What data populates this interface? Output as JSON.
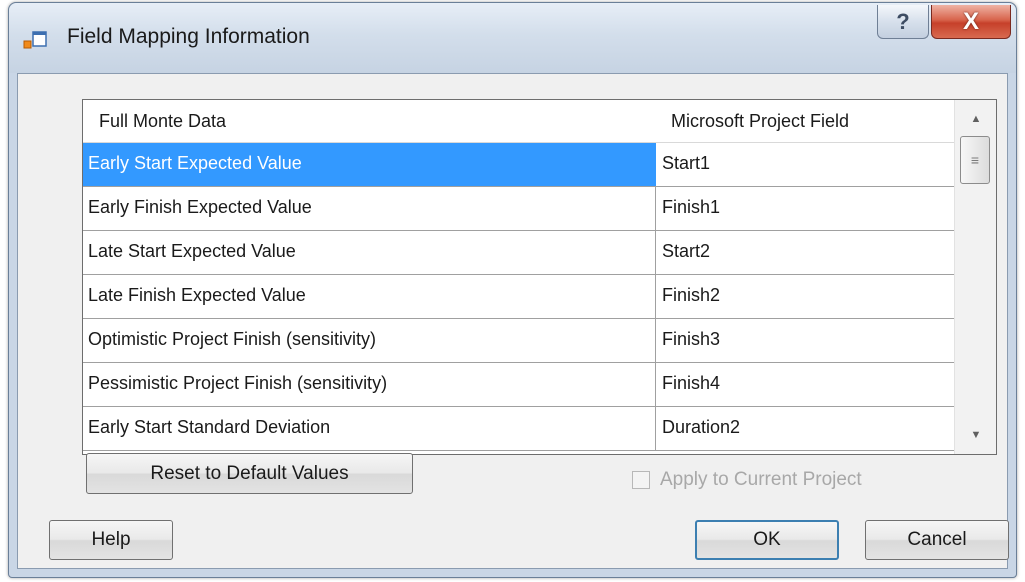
{
  "window": {
    "title": "Field Mapping Information",
    "help_glyph": "?",
    "close_glyph": "X",
    "icon": "app-form-icon"
  },
  "grid": {
    "columns": [
      "Full Monte Data",
      "Microsoft Project Field"
    ],
    "rows": [
      {
        "data": "Early Start Expected Value",
        "field": "Start1",
        "selected": true
      },
      {
        "data": "Early Finish Expected Value",
        "field": "Finish1"
      },
      {
        "data": "Late Start Expected Value",
        "field": "Start2"
      },
      {
        "data": "Late Finish Expected Value",
        "field": "Finish2"
      },
      {
        "data": "Optimistic Project Finish (sensitivity)",
        "field": "Finish3"
      },
      {
        "data": "Pessimistic Project Finish (sensitivity)",
        "field": "Finish4"
      },
      {
        "data": "Early Start Standard Deviation",
        "field": "Duration2"
      }
    ]
  },
  "buttons": {
    "reset": "Reset to Default Values",
    "help": "Help",
    "ok": "OK",
    "cancel": "Cancel"
  },
  "apply_checkbox": {
    "label": "Apply to Current Project",
    "checked": false,
    "enabled": false
  },
  "colors": {
    "selection": "#3399ff",
    "close_button": "#c6402a"
  }
}
